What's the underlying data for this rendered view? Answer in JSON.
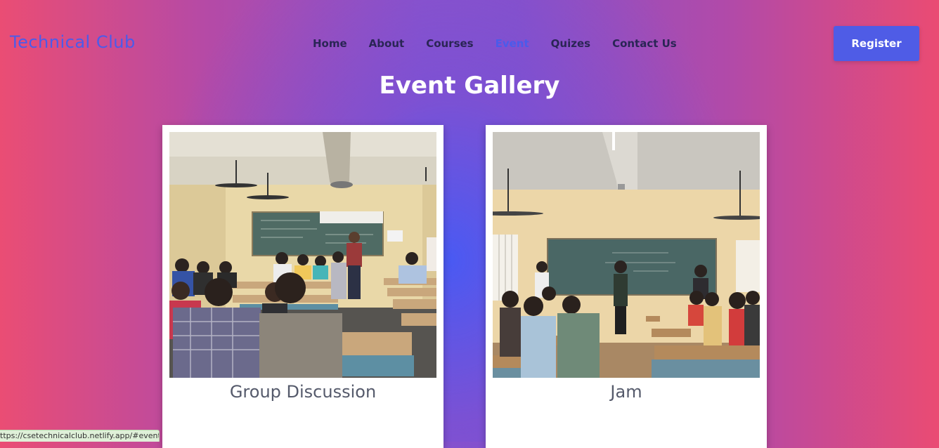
{
  "header": {
    "logo": "Technical Club",
    "nav": [
      "Home",
      "About",
      "Courses",
      "Event",
      "Quizes",
      "Contact Us"
    ],
    "active_nav": "Event",
    "register_label": "Register"
  },
  "main": {
    "title": "Event Gallery",
    "cards": [
      {
        "caption": "Group Discussion"
      },
      {
        "caption": "Jam"
      }
    ]
  },
  "status_bar": {
    "url": "ttps://csetechnicalclub.netlify.app/#event"
  },
  "colors": {
    "accent": "#4f5ce6",
    "nav_text": "#2a2555",
    "background_edge": "#ea4d74",
    "background_center": "#465af5"
  }
}
